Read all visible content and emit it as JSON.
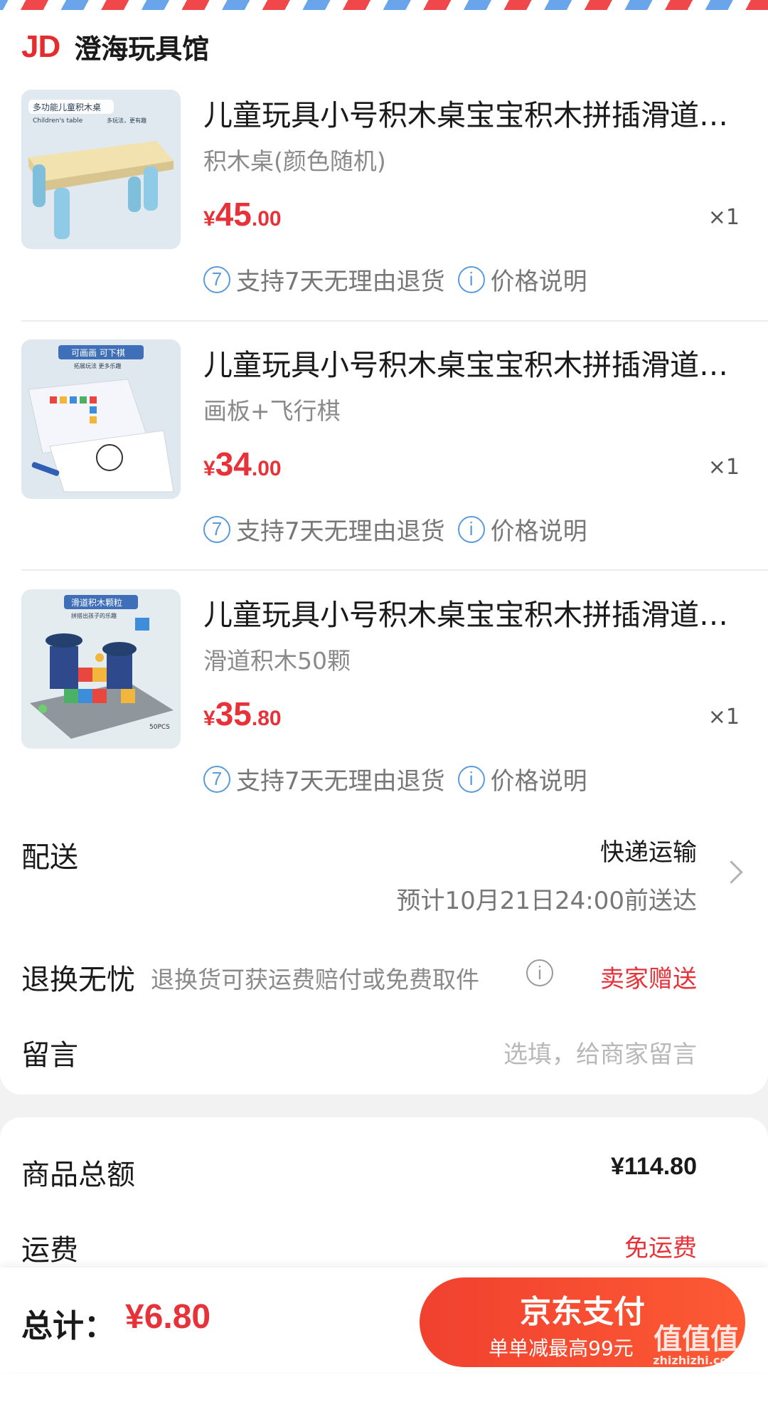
{
  "shop": {
    "logo": "JD",
    "name": "澄海玩具馆"
  },
  "items": [
    {
      "title": "儿童玩具小号积木桌宝宝积木拼插滑道拼装男孩女孩宝宝",
      "spec": "积木桌(颜色随机)",
      "price_symbol": "¥",
      "price_int": "45",
      "price_dec": ".00",
      "qty": "×1",
      "thumb_caption": "多功能儿童积木桌",
      "thumb_caption2": "Children's table",
      "thumb_caption3": "多玩法，更有趣",
      "tag1_icon": "7",
      "tag1": "支持7天无理由退货",
      "tag2_icon": "i",
      "tag2": "价格说明"
    },
    {
      "title": "儿童玩具小号积木桌宝宝积木拼插滑道拼装男孩女孩宝宝",
      "spec": "画板+飞行棋",
      "price_symbol": "¥",
      "price_int": "34",
      "price_dec": ".00",
      "qty": "×1",
      "thumb_caption": "可画画 可下棋",
      "thumb_caption2": "拓展玩法 更多乐趣",
      "tag1_icon": "7",
      "tag1": "支持7天无理由退货",
      "tag2_icon": "i",
      "tag2": "价格说明"
    },
    {
      "title": "儿童玩具小号积木桌宝宝积木拼插滑道拼装男孩女孩宝宝",
      "spec": "滑道积木50颗",
      "price_symbol": "¥",
      "price_int": "35",
      "price_dec": ".80",
      "qty": "×1",
      "thumb_caption": "滑道积木颗粒",
      "thumb_caption2": "拼搭出孩子的乐趣",
      "thumb_caption3": "50PCS",
      "tag1_icon": "7",
      "tag1": "支持7天无理由退货",
      "tag2_icon": "i",
      "tag2": "价格说明"
    }
  ],
  "delivery": {
    "label": "配送",
    "method": "快递运输",
    "eta": "预计10月21日24:00前送达"
  },
  "returns": {
    "label": "退换无忧",
    "desc": "退换货可获运费赔付或免费取件",
    "info_icon": "i",
    "badge": "卖家赠送"
  },
  "message": {
    "label": "留言",
    "placeholder": "选填，给商家留言"
  },
  "summary": {
    "goods_label": "商品总额",
    "goods_value": "¥114.80",
    "shipping_label": "运费",
    "shipping_value": "免运费"
  },
  "bottom": {
    "total_label": "总计：",
    "total_value": "¥6.80",
    "pay_label": "京东支付",
    "pay_sub": "单单减最高99元",
    "watermark": "值值值",
    "watermark_url": "zhizhizhi.com"
  },
  "colors": {
    "accent": "#e8323a",
    "pay_button": "#f0412f",
    "tag_icon": "#5b9bd9"
  }
}
